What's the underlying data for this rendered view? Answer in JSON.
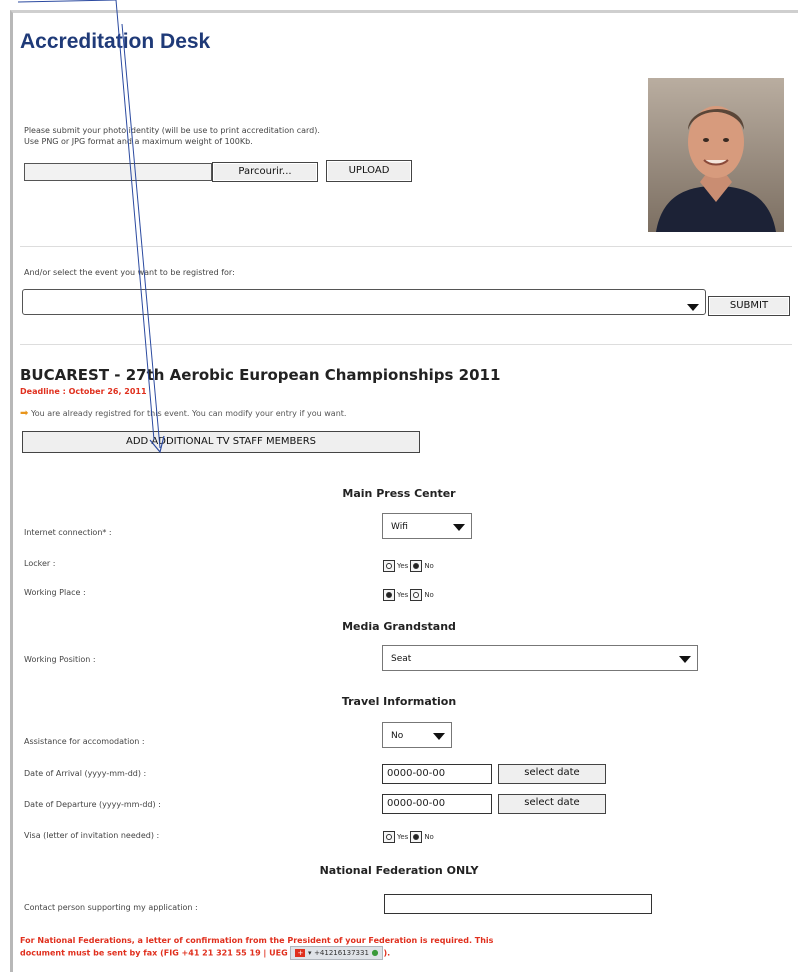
{
  "page": {
    "title": "Accreditation Desk"
  },
  "photo_upload": {
    "instruction_line1": "Please submit your photo identity (will be use to print accreditation card).",
    "instruction_line2": "Use PNG or JPG format and a maximum weight of 100Kb.",
    "file_value": "",
    "browse_label": "Parcourir...",
    "upload_label": "UPLOAD"
  },
  "event_select": {
    "prompt": "And/or select the event you want to be registred for:",
    "selected": "",
    "submit_label": "SUBMIT"
  },
  "event": {
    "name": "BUCAREST - 27th Aerobic European Championships 2011",
    "deadline": "Deadline : October 26, 2011",
    "notice": "You are already registred for this event. You can modify your entry if you want.",
    "add_staff_label": "ADD ADDITIONAL TV STAFF MEMBERS"
  },
  "sections": {
    "main_press": "Main Press Center",
    "media_grandstand": "Media Grandstand",
    "travel": "Travel Information",
    "national_federation": "National Federation ONLY"
  },
  "fields": {
    "internet_label": "Internet connection* :",
    "internet_value": "Wifi",
    "locker_label": "Locker :",
    "working_place_label": "Working Place :",
    "working_position_label": "Working Position :",
    "working_position_value": "Seat",
    "assistance_label": "Assistance for accomodation :",
    "assistance_value": "No",
    "arrival_label": "Date of Arrival (yyyy-mm-dd) :",
    "arrival_value": "0000-00-00",
    "departure_label": "Date of Departure (yyyy-mm-dd) :",
    "departure_value": "0000-00-00",
    "select_date_label": "select date",
    "visa_label": "Visa (letter of invitation needed) :",
    "contact_label": "Contact person supporting my application :",
    "contact_value": "",
    "yes": "Yes",
    "no": "No"
  },
  "radios": {
    "locker": "no",
    "working_place": "yes",
    "visa": "no"
  },
  "footer": {
    "line1": "For National Federations, a letter of confirmation from the President of your Federation is required. This",
    "line2": "document must be sent by fax (FIG +41 21 321 55 19 | UEG",
    "phone": "+41216137331",
    "line2_end": ")."
  },
  "colors": {
    "title": "#1f3a78",
    "alert": "#e0301e",
    "notice_icon": "#e8951b",
    "annotation_arrow": "#2b4aa0"
  }
}
